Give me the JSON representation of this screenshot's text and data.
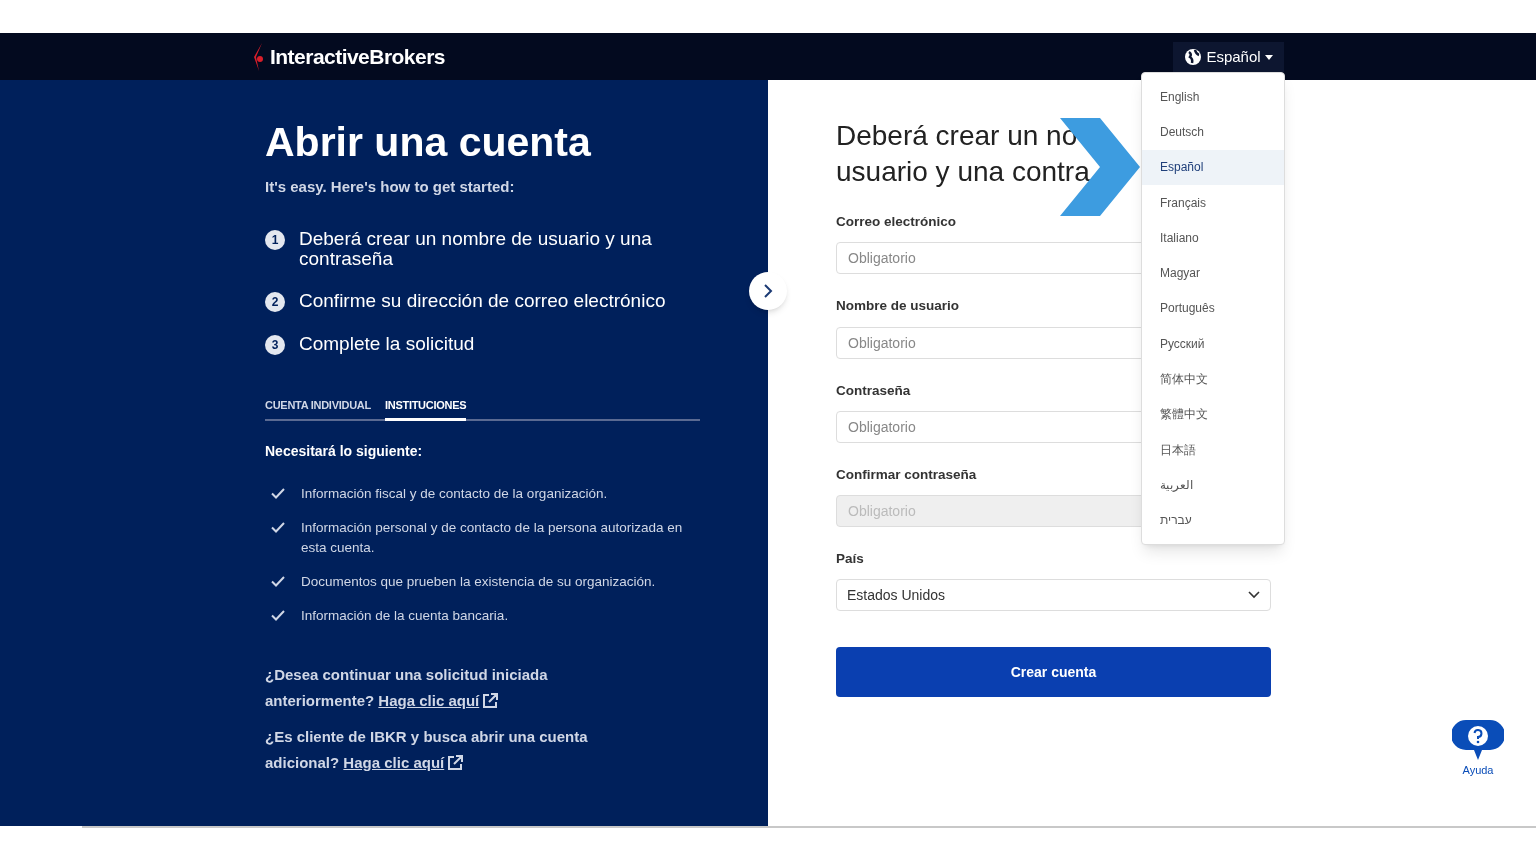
{
  "header": {
    "logo": "InteractiveBrokers",
    "language_button": "Español"
  },
  "left_panel": {
    "title": "Abrir una cuenta",
    "subtitle": "It's easy. Here's how to get started:",
    "steps": [
      {
        "number": "1",
        "text": "Deberá crear un nombre de usuario y una contraseña"
      },
      {
        "number": "2",
        "text": "Confirme su dirección de correo electrónico"
      },
      {
        "number": "3",
        "text": "Complete la solicitud"
      }
    ],
    "tabs": [
      {
        "label": "CUENTA INDIVIDUAL",
        "selected": false
      },
      {
        "label": "INSTITUCIONES",
        "selected": true
      }
    ],
    "requirements_heading": "Necesitará lo siguiente:",
    "requirements": [
      "Información fiscal y de contacto de la organización.",
      "Información personal y de contacto de la persona autorizada en esta cuenta.",
      "Documentos que prueben la existencia de su organización.",
      "Información de la cuenta bancaria."
    ],
    "links": [
      {
        "text": "¿Desea continuar una solicitud iniciada anteriormente?",
        "link": "Haga clic aquí"
      },
      {
        "text": "¿Es cliente de IBKR y busca abrir una cuenta adicional?",
        "link": "Haga clic aquí"
      }
    ]
  },
  "form": {
    "heading_lines": [
      "Deberá crear un no",
      "usuario y una contra"
    ],
    "fields": [
      {
        "label": "Correo electrónico",
        "placeholder": "Obligatorio",
        "disabled": false
      },
      {
        "label": "Nombre de usuario",
        "placeholder": "Obligatorio",
        "disabled": false
      },
      {
        "label": "Contraseña",
        "placeholder": "Obligatorio",
        "disabled": false
      },
      {
        "label": "Confirmar contraseña",
        "placeholder": "Obligatorio",
        "disabled": true
      }
    ],
    "country": {
      "label": "País",
      "value": "Estados Unidos"
    },
    "submit": "Crear cuenta"
  },
  "language_menu": [
    {
      "label": "English",
      "selected": false
    },
    {
      "label": "Deutsch",
      "selected": false
    },
    {
      "label": "Español",
      "selected": true
    },
    {
      "label": "Français",
      "selected": false
    },
    {
      "label": "Italiano",
      "selected": false
    },
    {
      "label": "Magyar",
      "selected": false
    },
    {
      "label": "Português",
      "selected": false
    },
    {
      "label": "Русский",
      "selected": false
    },
    {
      "label": "简体中文",
      "selected": false
    },
    {
      "label": "繁體中文",
      "selected": false
    },
    {
      "label": "日本語",
      "selected": false
    },
    {
      "label": "العربية",
      "selected": false
    },
    {
      "label": "עברית",
      "selected": false
    }
  ],
  "help": {
    "label": "Ayuda"
  }
}
